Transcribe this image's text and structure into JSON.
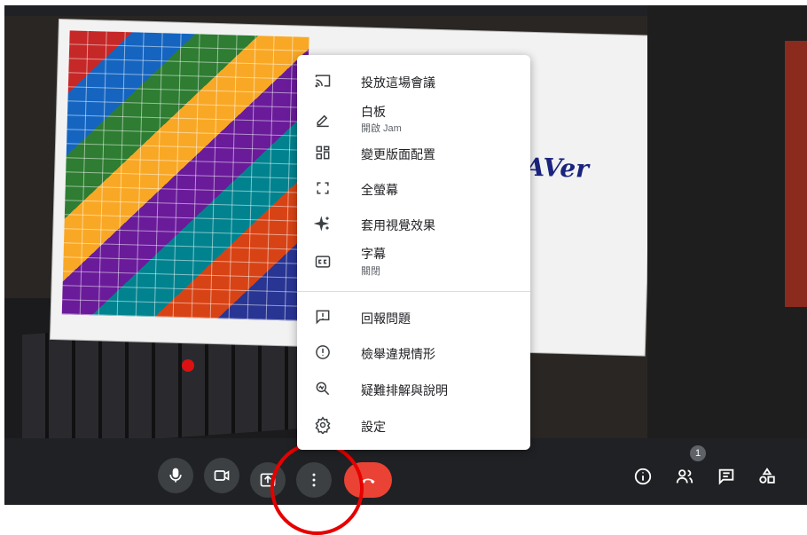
{
  "menu": {
    "items": [
      {
        "label": "投放這場會議",
        "icon": "cast-icon"
      },
      {
        "label": "白板",
        "sub": "開啟 Jam",
        "icon": "pen-icon"
      },
      {
        "label": "變更版面配置",
        "icon": "layout-icon"
      },
      {
        "label": "全螢幕",
        "icon": "fullscreen-icon"
      },
      {
        "label": "套用視覺效果",
        "icon": "sparkle-icon"
      },
      {
        "label": "字幕",
        "sub": "關閉",
        "icon": "captions-icon"
      },
      {
        "label": "回報問題",
        "icon": "report-problem-icon"
      },
      {
        "label": "檢舉違規情形",
        "icon": "report-abuse-icon"
      },
      {
        "label": "疑難排解與說明",
        "icon": "troubleshoot-icon"
      },
      {
        "label": "設定",
        "icon": "gear-icon"
      }
    ]
  },
  "video": {
    "logo_text": "AVer"
  },
  "toolbar": {
    "participants_count": "1",
    "hangup_color": "#ea4335",
    "annotation_color": "#e60000"
  }
}
